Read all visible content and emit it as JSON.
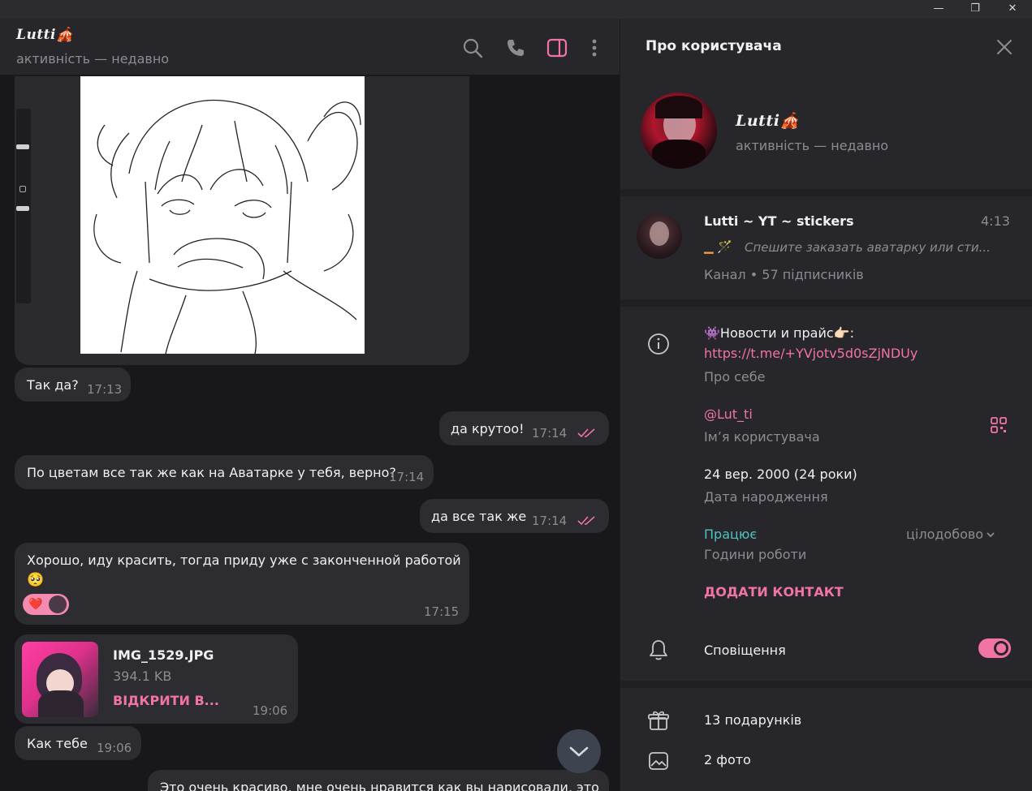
{
  "window": {
    "minimize": "—",
    "maximize": "❐",
    "close": "✕"
  },
  "chat": {
    "title": "Lutti🎪",
    "status": "активність — недавно"
  },
  "messages": [
    {
      "text": "Так да?",
      "time": "17:13"
    },
    {
      "text": "да крутоо!",
      "time": "17:14"
    },
    {
      "text": "По цветам все так же как на Аватарке у тебя, верно?",
      "time": "17:14"
    },
    {
      "text": "да все так же",
      "time": "17:14"
    },
    {
      "text": "Хорошо, иду красить, тогда приду уже с законченной работой",
      "emoji": "🥺",
      "time": "17:15"
    },
    {
      "text": "Как тебе",
      "time": "19:06"
    },
    {
      "text": "Это очень красиво, мне очень нравится как вы нарисовали, это"
    }
  ],
  "file": {
    "name": "IMG_1529.JPG",
    "size": "394.1 KB",
    "action": "ВІДКРИТИ В...",
    "time": "19:06"
  },
  "reaction": {
    "emoji": "❤️"
  },
  "panel": {
    "title": "Про користувача",
    "name": "Lutti🎪",
    "status": "активність — недавно",
    "channel": {
      "name": "Lutti ~ YT ~ stickers",
      "time": "4:13",
      "preview": "Спешите заказать аватарку или сти...",
      "preview_prefix": "▁ 🪄",
      "meta": "Канал • 57 підписників"
    },
    "bio": {
      "text": "👾Новости и прайс👉🏻:",
      "link": "https://t.me/+YVjotv5d0sZjNDUy",
      "label": "Про себе"
    },
    "username": {
      "value": "@Lut_ti",
      "label": "Імʼя користувача"
    },
    "birthday": {
      "value": "24 вер. 2000 (24 роки)",
      "label": "Дата народження"
    },
    "hours": {
      "status": "Працює",
      "schedule": "цілодобово",
      "label": "Години роботи"
    },
    "add_contact": "ДОДАТИ КОНТАКТ",
    "notifications": {
      "label": "Сповіщення",
      "enabled": true
    },
    "gifts": "13 подарунків",
    "photos": "2 фото"
  },
  "colors": {
    "accent": "#f273a6",
    "online": "#4fc3c0",
    "background": "#17171c",
    "panel": "#26262b",
    "bubble": "#2c2c31"
  }
}
